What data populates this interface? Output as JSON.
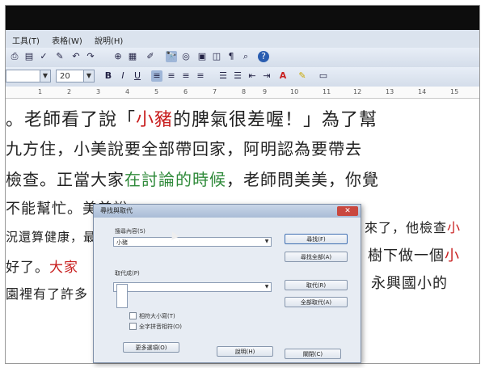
{
  "menu": {
    "tools": "工具(T)",
    "table": "表格(W)",
    "help": "說明(H)"
  },
  "font_size": "20",
  "ruler_marks": [
    "1",
    "2",
    "3",
    "4",
    "5",
    "6",
    "7",
    "8",
    "9",
    "10",
    "11",
    "12",
    "13",
    "14",
    "15"
  ],
  "doc_lines": [
    {
      "parts": [
        {
          "t": "。老師看了說「",
          "c": ""
        },
        {
          "t": "小豬",
          "c": "red"
        },
        {
          "t": "的脾氣很差喔！」為了幫",
          "c": ""
        }
      ]
    },
    {
      "parts": [
        {
          "t": "九方住，小美說要全部帶回家，阿明認為要帶去",
          "c": ""
        }
      ]
    },
    {
      "parts": [
        {
          "t": "檢查。正當大家",
          "c": ""
        },
        {
          "t": "在討論的時候",
          "c": "green"
        },
        {
          "t": "，老師問美美，你覺",
          "c": ""
        }
      ]
    },
    {
      "parts": [
        {
          "t": "不能幫忙。美美說",
          "c": ""
        }
      ]
    },
    {
      "parts": [
        {
          "t": "況還算健康，最",
          "c": ""
        }
      ]
    },
    {
      "parts": [
        {
          "t": "好了。",
          "c": ""
        },
        {
          "t": "大家",
          "c": "red"
        }
      ]
    },
    {
      "parts": [
        {
          "t": "園裡有了許多",
          "c": ""
        }
      ]
    }
  ],
  "doc_right": [
    {
      "parts": [
        {
          "t": "來了，他檢查",
          "c": ""
        },
        {
          "t": "小",
          "c": "red"
        }
      ]
    },
    {
      "parts": [
        {
          "t": "樹下做一個",
          "c": ""
        },
        {
          "t": "小",
          "c": "red"
        }
      ]
    },
    {
      "parts": [
        {
          "t": "永興國小的",
          "c": ""
        }
      ]
    }
  ],
  "dialog": {
    "title": "尋找與取代",
    "close": "✕",
    "find_label": "搜尋內容(S)",
    "find_value": "小豬",
    "replace_label": "取代成(P)",
    "replace_value": "",
    "match_case": "相符大小寫(T)",
    "whole_word": "全字拼音相符(O)",
    "more_options": "更多選項(O)",
    "btn_find": "尋找(F)",
    "btn_find_all": "尋找全部(A)",
    "btn_replace": "取代(R)",
    "btn_replace_all": "全部取代(A)",
    "btn_help": "說明(H)",
    "btn_close": "關閉(C)"
  }
}
